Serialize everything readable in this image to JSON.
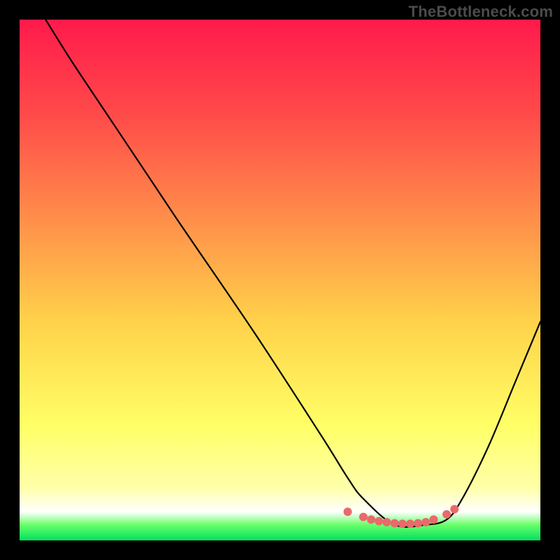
{
  "watermark": "TheBottleneck.com",
  "chart_data": {
    "type": "line",
    "title": "",
    "xlabel": "",
    "ylabel": "",
    "xlim": [
      0,
      100
    ],
    "ylim": [
      0,
      100
    ],
    "grid": false,
    "legend": false,
    "gradient": {
      "stops": [
        {
          "offset": 0.0,
          "color": "#ff1a4b"
        },
        {
          "offset": 0.18,
          "color": "#ff4a4a"
        },
        {
          "offset": 0.4,
          "color": "#ff944a"
        },
        {
          "offset": 0.58,
          "color": "#ffd24a"
        },
        {
          "offset": 0.78,
          "color": "#ffff66"
        },
        {
          "offset": 0.9,
          "color": "#ffffaa"
        },
        {
          "offset": 0.945,
          "color": "#ffffff"
        },
        {
          "offset": 0.97,
          "color": "#6aff6a"
        },
        {
          "offset": 1.0,
          "color": "#00e060"
        }
      ]
    },
    "series": [
      {
        "name": "bottleneck-curve",
        "color": "#000000",
        "width": 2.2,
        "x": [
          5,
          10,
          18,
          30,
          45,
          58,
          63,
          66,
          72,
          78,
          82,
          85,
          90,
          95,
          100
        ],
        "y": [
          100,
          92,
          80,
          62,
          40,
          20,
          12,
          8,
          3,
          3,
          4,
          8,
          18,
          30,
          42
        ]
      }
    ],
    "markers": {
      "name": "optimal-range-dots",
      "color": "#e86a6a",
      "radius": 6,
      "points": [
        {
          "x": 63,
          "y": 5.5
        },
        {
          "x": 66,
          "y": 4.5
        },
        {
          "x": 67.5,
          "y": 4
        },
        {
          "x": 69,
          "y": 3.7
        },
        {
          "x": 70.5,
          "y": 3.5
        },
        {
          "x": 72,
          "y": 3.3
        },
        {
          "x": 73.5,
          "y": 3.2
        },
        {
          "x": 75,
          "y": 3.2
        },
        {
          "x": 76.5,
          "y": 3.3
        },
        {
          "x": 78,
          "y": 3.5
        },
        {
          "x": 79.5,
          "y": 4
        },
        {
          "x": 82,
          "y": 5
        },
        {
          "x": 83.5,
          "y": 6
        }
      ]
    }
  }
}
